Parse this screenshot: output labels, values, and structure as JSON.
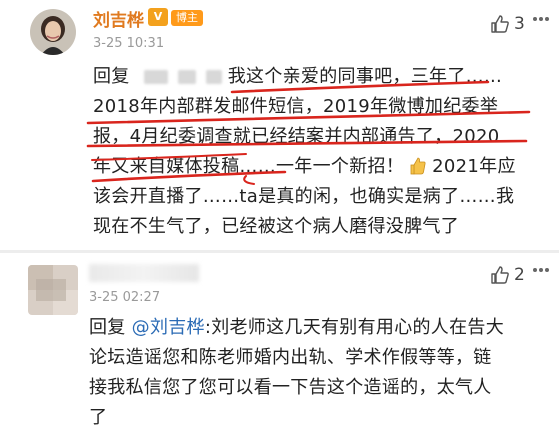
{
  "comments": [
    {
      "username": "刘吉桦",
      "vip_badge": "V",
      "role_badge": "博主",
      "time": "3-25 10:31",
      "likes": "3",
      "lines": [
        "回复",
        "我这个亲爱的同事吧，三年了……",
        "2018年内部群发邮件短信，2019年微博加纪委举",
        "报，4月纪委调查就已经结案并内部通告了，2020",
        "年又来自媒体投稿……一年一个新招！",
        "2021年应",
        "该会开直播了……ta是真的闲，也确实是病了……我",
        "现在不生气了，已经被这个病人磨得没脾气了"
      ]
    },
    {
      "username": "",
      "time": "3-25 02:27",
      "likes": "2",
      "reply_prefix": "回复",
      "mention": "@刘吉桦",
      "lines": [
        ":刘老师这几天有别有用心的人在告大",
        "论坛造谣您和陈老师婚内出轨、学术作假等等，链",
        "接我私信您了您可以看一下告这个造谣的，太气人",
        "了"
      ]
    }
  ],
  "colors": {
    "username": "#e07a1f",
    "mention": "#2b6bb5",
    "annotation_red": "#d9251d"
  }
}
